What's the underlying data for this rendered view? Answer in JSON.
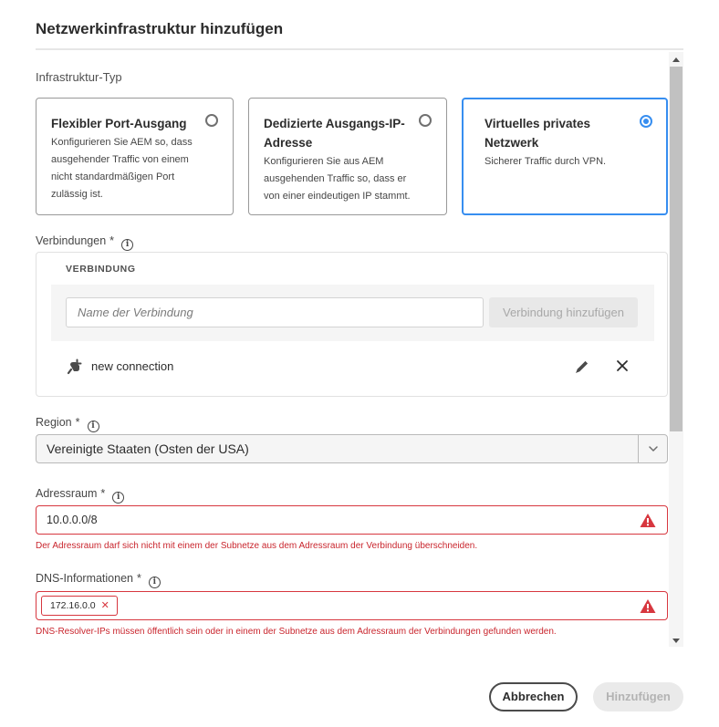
{
  "dialog": {
    "title": "Netzwerkinfrastruktur hinzufügen"
  },
  "infrastructure_type": {
    "label": "Infrastruktur-Typ",
    "options": [
      {
        "title_line1": "Flexibler Port-Ausgang",
        "title_line2": "",
        "description": "Konfigurieren Sie AEM so, dass ausgehender Traffic von einem nicht standardmäßigen Port zulässig ist.",
        "selected": false
      },
      {
        "title_line1": "Dedizierte Ausgangs-IP-",
        "title_line2": "Adresse",
        "description": "Konfigurieren Sie aus AEM ausgehenden Traffic so, dass er von einer eindeutigen IP stammt.",
        "selected": false
      },
      {
        "title_line1": "Virtuelles privates",
        "title_line2": "Netzwerk",
        "description": "Sicherer Traffic durch VPN.",
        "selected": true
      }
    ]
  },
  "connections": {
    "label": "Verbindungen",
    "required_mark": "*",
    "header": "VERBINDUNG",
    "input_placeholder": "Name der Verbindung",
    "add_button": "Verbindung hinzufügen",
    "items": [
      {
        "name": "new connection"
      }
    ]
  },
  "region": {
    "label": "Region",
    "required_mark": "*",
    "value": "Vereinigte Staaten (Osten der USA)"
  },
  "address_space": {
    "label": "Adressraum",
    "required_mark": "*",
    "value": "10.0.0.0/8",
    "error": "Der Adressraum darf sich nicht mit einem der Subnetze aus dem Adressraum der Verbindung überschneiden."
  },
  "dns": {
    "label": "DNS-Informationen",
    "required_mark": "*",
    "tags": [
      "172.16.0.0"
    ],
    "error": "DNS-Resolver-IPs müssen öffentlich sein oder in einem der Subnetze aus dem Adressraum der Verbindungen gefunden werden."
  },
  "footer": {
    "cancel": "Abbrechen",
    "submit": "Hinzufügen"
  },
  "colors": {
    "accent": "#378ef0",
    "error": "#d7373f",
    "error_text": "#c9252d"
  },
  "icons": {
    "info": "info-icon",
    "plug": "plug-icon",
    "edit": "pencil-icon",
    "remove": "close-icon",
    "warning": "alert-triangle-icon",
    "dropdown": "chevron-down-icon"
  }
}
